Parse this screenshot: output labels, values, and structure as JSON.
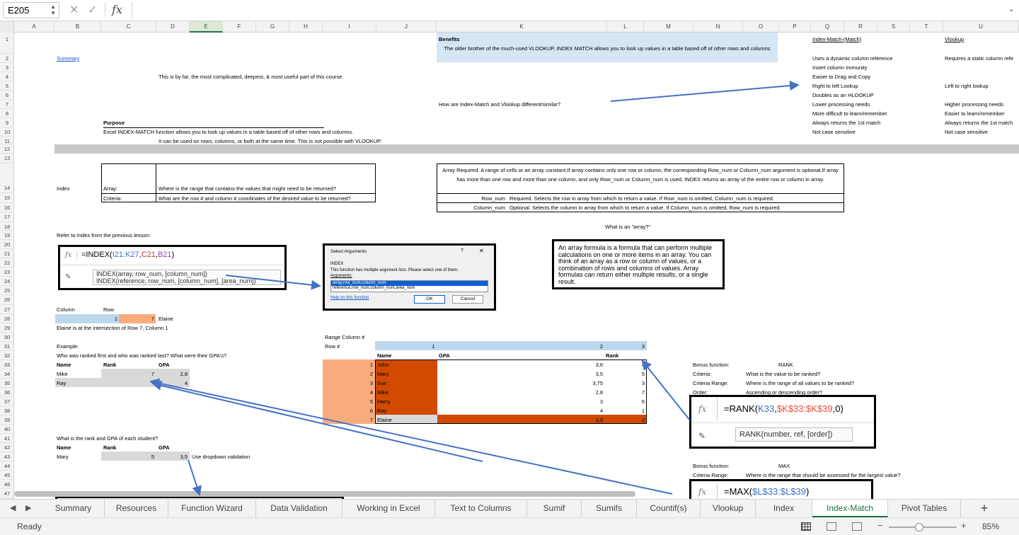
{
  "formula_bar": {
    "name_box": "E205",
    "cancel_icon": "✕",
    "confirm_icon": "✓",
    "fx_label": "fx",
    "formula": ""
  },
  "columns": [
    "A",
    "B",
    "C",
    "D",
    "E",
    "F",
    "G",
    "H",
    "I",
    "J",
    "K",
    "L",
    "M",
    "N",
    "O",
    "P",
    "Q",
    "R",
    "S",
    "T",
    "U"
  ],
  "selected_column": "E",
  "rows": [
    "1",
    "2",
    "3",
    "4",
    "5",
    "6",
    "7",
    "8",
    "9",
    "10",
    "11",
    "12",
    "13",
    "14",
    "15",
    "16",
    "17",
    "18",
    "19",
    "20",
    "21",
    "22",
    "23",
    "24",
    "25",
    "26",
    "27",
    "28",
    "29",
    "30",
    "31",
    "32",
    "33",
    "34",
    "35",
    "36",
    "37",
    "38",
    "39",
    "40",
    "41",
    "42",
    "43",
    "44",
    "45",
    "46",
    "47"
  ],
  "sheet": {
    "summary_link": "Summary",
    "intro": "This is by far, the most complicated, deepest, & most useful part of this course.",
    "purpose_heading": "Purpose",
    "purpose_1": "Excel INDEX-MATCH function allows you to look up values in a table based off of other rows and columns.",
    "purpose_2": "It can be used on rows, columns, or both at the same time. This is not possible with VLOOKUP.",
    "benefits_heading": "Benefits",
    "benefits_text": "The older brother of the much-used VLOOKUP, INDEX MATCH allows you to look up values in a table based off of other rows and columns",
    "compare_question": "How are Index-Match and Vlookup different/similar?",
    "im_heading": "Index-Match-(Match)",
    "im_items": [
      "Uses a dynamic column reference",
      "Insert column Immunity",
      "Easier to Drag and Copy",
      "Right to left Lookup",
      "Doubles as an HLOOKUP",
      "Lower processing needs",
      "More difficult to learn/remember",
      "Always returns the 1st match",
      "Not case sensitive"
    ],
    "vl_heading": "Vlookup",
    "vl_items": [
      "Requires a static column refe",
      "",
      "",
      "Left to right lookup",
      "",
      "Higher processing needs",
      "Easier to learn/remember",
      "Always returns the 1st match",
      "Not case sensitive"
    ],
    "index_label": "Index",
    "array_label": "Array:",
    "array_desc": "Where is the range that contains the values that might need to be returned?",
    "criteria_label": "Criteria:",
    "criteria_desc": "What are the row # and column # coordinates of the desired value to be returned?",
    "arg_array_desc": "Array    Required. A range of cells or an array constant.If array contains only one row or column, the corresponding Row_num or Column_num argument is optional.If array has more than one row and more than one column, and only Row_num or Column_num is used, INDEX returns an array of the entire row or column in array.",
    "arg_row_name": "Row_num",
    "arg_row_desc": "Required. Selects the row in array from which to return a value. If Row_num is omitted, Column_num is required.",
    "arg_col_name": "Column_num",
    "arg_col_desc": "Optional. Selects the column in array from which to return a value. If Column_num is omitted, Row_num is required.",
    "refer_text": "Refer to Index from the previous lesson:",
    "what_is_array": "What is an \"array?\"",
    "column_hdr": "Column",
    "row_hdr": "Row",
    "col_val": "1",
    "row_val": "7",
    "elaine": "Elaine",
    "intersection_text": "Elaine is at the intersection of Row 7, Column 1",
    "example_label": "Example:",
    "example_question": "Who was ranked first and who was ranked last? What were their GPA's?",
    "name_hdr": "Name",
    "rank_hdr": "Rank",
    "gpa_hdr": "GPA",
    "example_rows": [
      {
        "name": "Mike",
        "rank": "7",
        "gpa": "2,8"
      },
      {
        "name": "Ray",
        "rank": "",
        "gpa": "4"
      }
    ],
    "rank_question": "What is the rank and GPA of each student?",
    "mary_name": "Mary",
    "mary_rank": "5",
    "mary_gpa": "3,5",
    "dropdown_note": "Use dropdown validation",
    "range_column_label": "Range Column #",
    "row_num_label": "Row #",
    "range_cols": [
      "1",
      "2",
      "3"
    ],
    "table_rows": [
      {
        "n": "1",
        "name": "John",
        "gpa": "3,6",
        "rank": "4"
      },
      {
        "n": "2",
        "name": "Mary",
        "gpa": "3,5",
        "rank": "5"
      },
      {
        "n": "3",
        "name": "Sue",
        "gpa": "3,75",
        "rank": "3"
      },
      {
        "n": "4",
        "name": "Mike",
        "gpa": "2,8",
        "rank": "7"
      },
      {
        "n": "5",
        "name": "Harry",
        "gpa": "3",
        "rank": "6"
      },
      {
        "n": "6",
        "name": "Ray",
        "gpa": "4",
        "rank": "1"
      },
      {
        "n": "7",
        "name": "Elaine",
        "gpa": "3,9",
        "rank": "2"
      }
    ],
    "bonus_label": "Bonus function:",
    "bonus_rank": "RANK",
    "b_criteria_label": "Criteria:",
    "b_criteria_desc": "What is the value to be ranked?",
    "b_range_label": "Criteria Range:",
    "b_range_desc": "Where is the range of all values to be ranked?",
    "b_order_label": "Order:",
    "b_order_desc": "Ascending or descending order?",
    "bonus_label2": "Bonus function:",
    "bonus_max": "MAX",
    "b_range_label2": "Criteria Range:",
    "b_range_desc2": "Where is the range that should be assessed for the largest value?"
  },
  "index_formula": {
    "fx": "fx",
    "eq": "=INDEX(",
    "ref1": "I21:K27",
    "c1": ",",
    "ref2": "C21",
    "c2": ",",
    "ref3": "B21",
    "close": ")",
    "tip1": "INDEX(array, row_num, [column_num])",
    "tip2": "INDEX(reference, row_num, [column_num], [area_num])"
  },
  "dialog": {
    "title": "Select Arguments",
    "help": "?",
    "close": "✕",
    "fn": "INDEX",
    "info": "This function has multiple argument lists.  Please select one of them.",
    "args_label": "Arguments:",
    "opt1": "array,row_num,column_num",
    "opt2": "reference,row_num,column_num,area_num",
    "help_link": "Help on this function",
    "ok": "OK",
    "cancel": "Cancel"
  },
  "array_def": {
    "text": "An array formula is a formula that can perform multiple calculations on one or more items in an array. You can think of an array as a row or column of values, or a combination of rows and columns of values. Array formulas can return either multiple results, or a single result."
  },
  "rank_formula": {
    "fx": "fx",
    "eq": "=RANK(",
    "ref1": "K33",
    "c1": ",",
    "ref2": "$K$33:$K$39",
    "c2": ",",
    "tail": "0)",
    "tip": "RANK(number, ref, [order])"
  },
  "max_formula": {
    "fx": "fx",
    "eq": "=MAX(",
    "ref1": "$L$33:$L$39",
    "close": ")"
  },
  "tabs": [
    "Summary",
    "Resources",
    "Function Wizard",
    "Data Validation",
    "Working in Excel",
    "Text to Columns",
    "Sumif",
    "Sumifs",
    "Countif(s)",
    "Vlookup",
    "Index",
    "Index-Match",
    "Pivot Tables"
  ],
  "active_tab": "Index-Match",
  "add_sheet": "+",
  "status": {
    "ready": "Ready",
    "minus": "−",
    "plus": "+",
    "zoom": "85%",
    "zoom_level": 0.45
  },
  "colors": {
    "accent": "#217346",
    "light_blue": "#bdd7ee",
    "dark_orange": "#d14a00",
    "light_orange": "#f8ac7e",
    "grey": "#d9d9d9",
    "arrow": "#4472c4"
  }
}
